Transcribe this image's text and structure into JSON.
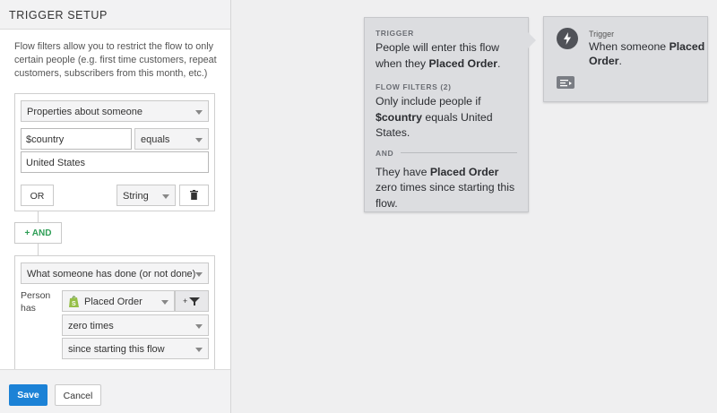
{
  "panel": {
    "title": "TRIGGER SETUP",
    "intro": "Flow filters allow you to restrict the flow to only certain people (e.g. first time customers, repeat customers, subscribers from this month, etc.)"
  },
  "group1": {
    "condition_type": "Properties about someone",
    "property": "$country",
    "operator": "equals",
    "value": "United States",
    "or_label": "OR",
    "datatype": "String"
  },
  "and_button": {
    "label": "AND"
  },
  "group2": {
    "condition_type": "What someone has done (or not done)",
    "person_has": "Person has",
    "event": "Placed Order",
    "frequency": "zero times",
    "timeframe": "since starting this flow"
  },
  "footer": {
    "save": "Save",
    "cancel": "Cancel"
  },
  "canvas": {
    "summary_card": {
      "trigger_caption": "TRIGGER",
      "trigger_text_prefix": "People will enter this flow when they",
      "trigger_event": "Placed Order",
      "filters_caption": "FLOW FILTERS (2)",
      "filter1_prefix": "Only include people if",
      "filter1_property": "$country",
      "filter1_suffix": "equals United States.",
      "and_caption": "AND",
      "filter2_prefix": "They have",
      "filter2_event": "Placed Order",
      "filter2_suffix": "zero times since starting this flow."
    },
    "trigger_node": {
      "caption": "Trigger",
      "text_prefix": "When someone",
      "event": "Placed Order"
    }
  },
  "colors": {
    "primary": "#1c82d6",
    "and_green": "#2e9e56",
    "card_bg": "#dcdde0"
  },
  "icons": [
    "trash-icon",
    "plus-icon",
    "add-filter-icon",
    "shopify-icon",
    "lightning-bolt-icon",
    "notes-icon"
  ]
}
